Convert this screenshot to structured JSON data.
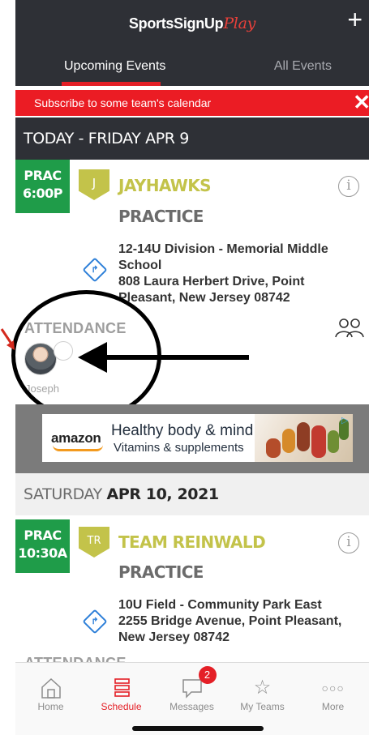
{
  "header": {
    "logo_main": "SportsSignUp",
    "logo_script": "Play",
    "add_symbol": "+",
    "tabs": [
      {
        "label": "Upcoming Events",
        "active": true
      },
      {
        "label": "All Events",
        "active": false
      }
    ]
  },
  "banner": {
    "text": "Subscribe to some team's calendar",
    "close": "✕"
  },
  "days": [
    {
      "header_light": "TODAY - FRIDAY APR 9",
      "header_bold": "",
      "event": {
        "badge_line1": "PRAC",
        "badge_line2": "6:00P",
        "team_initial": "J",
        "team_name": "JAYHAWKS",
        "event_type": "PRACTICE",
        "location": "12-14U Division - Memorial Middle School\n808 Laura Herbert Drive, Point Pleasant, New Jersey 08742",
        "attendance_label": "ATTENDANCE",
        "attendee_name": "Joseph"
      }
    },
    {
      "header_light": "SATURDAY ",
      "header_bold": "APR 10, 2021",
      "event": {
        "badge_line1": "PRAC",
        "badge_line2": "10:30A",
        "team_initial": "TR",
        "team_name": "TEAM REINWALD",
        "event_type": "PRACTICE",
        "location": "10U Field - Community Park East\n2255 Bridge Avenue, Point Pleasant, New Jersey 08742",
        "attendance_label": "ATTENDANCE"
      }
    }
  ],
  "ad": {
    "brand": "amazon",
    "title": "Healthy body & mind",
    "subtitle": "Vitamins & supplements",
    "choice_icon": "▷"
  },
  "tabbar": [
    {
      "label": "Home",
      "icon": "home-icon",
      "active": false
    },
    {
      "label": "Schedule",
      "icon": "schedule-icon",
      "active": true
    },
    {
      "label": "Messages",
      "icon": "messages-icon",
      "active": false,
      "badge": "2"
    },
    {
      "label": "My Teams",
      "icon": "star-icon",
      "active": false
    },
    {
      "label": "More",
      "icon": "more-icon",
      "active": false
    }
  ],
  "colors": {
    "header_bg": "#2e3036",
    "accent_red": "#e41f26",
    "event_green": "#1f9c49",
    "team_olive": "#c3c34a",
    "location_blue": "#2d7fd8"
  }
}
